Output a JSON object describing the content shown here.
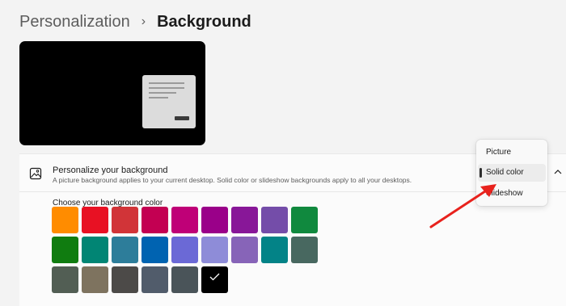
{
  "breadcrumb": {
    "parent": "Personalization",
    "separator": "›",
    "current": "Background"
  },
  "preview": {
    "background_color": "#000000"
  },
  "background_setting": {
    "icon": "picture-icon",
    "title": "Personalize your background",
    "description": "A picture background applies to your current desktop. Solid color or slideshow backgrounds apply to all your desktops.",
    "expand_icon": "chevron-up-icon"
  },
  "dropdown": {
    "options": [
      "Picture",
      "Solid color",
      "Slideshow"
    ],
    "selected": "Solid color"
  },
  "colors": {
    "label": "Choose your background color",
    "rows": [
      [
        "#ff8c00",
        "#e81123",
        "#d13438",
        "#c30052",
        "#bf0077",
        "#9a0089",
        "#881798",
        "#744da9",
        "#10893e"
      ],
      [
        "#107c10",
        "#018574",
        "#2d7d9a",
        "#0063b1",
        "#6b69d6",
        "#8e8cd8",
        "#8764b8",
        "#038387",
        "#486860"
      ],
      [
        "#525e54",
        "#7e735f",
        "#4c4a48",
        "#515c6b",
        "#4a5459",
        "#000000"
      ]
    ],
    "selected": "#000000"
  },
  "annotation": {
    "arrow_color": "#e8221d"
  }
}
